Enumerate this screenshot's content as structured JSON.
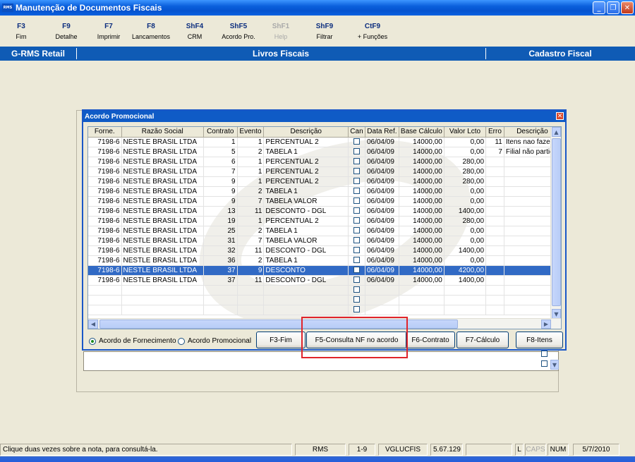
{
  "window": {
    "title": "Manutenção de Documentos Fiscais",
    "icon_text": "RMS",
    "controls": [
      "minimize-icon",
      "restore-icon",
      "close-icon"
    ]
  },
  "fkeys": [
    {
      "key": "F3",
      "label": "Fim"
    },
    {
      "key": "F9",
      "label": "Detalhe"
    },
    {
      "key": "F7",
      "label": "Imprimir"
    },
    {
      "key": "F8",
      "label": "Lancamentos"
    },
    {
      "key": "ShF4",
      "label": "CRM"
    },
    {
      "key": "ShF5",
      "label": "Acordo Pro."
    },
    {
      "key": "ShF1",
      "label": "Help",
      "disabled": true
    },
    {
      "key": "ShF9",
      "label": "Filtrar"
    },
    {
      "key": "CtF9",
      "label": "+ Funções"
    }
  ],
  "header": {
    "left": "G-RMS Retail",
    "center": "Livros Fiscais",
    "right": "Cadastro Fiscal"
  },
  "dialog": {
    "title": "Acordo Promocional",
    "columns": [
      "Forne.",
      "Razão Social",
      "Contrato",
      "Evento",
      "Descrição",
      "Can",
      "Data Ref.",
      "Base Cálculo",
      "Valor Lcto",
      "Erro",
      "Descrição"
    ],
    "rows": [
      [
        "7198-6",
        "NESTLE BRASIL LTDA",
        "1",
        "1",
        "PERCENTUAL 2",
        "",
        "06/04/09",
        "14000,00",
        "0,00",
        "11",
        "Itens nao fazem"
      ],
      [
        "7198-6",
        "NESTLE BRASIL LTDA",
        "5",
        "2",
        "TABELA 1",
        "",
        "06/04/09",
        "14000,00",
        "0,00",
        "7",
        "Filial não particip"
      ],
      [
        "7198-6",
        "NESTLE BRASIL LTDA",
        "6",
        "1",
        "PERCENTUAL 2",
        "",
        "06/04/09",
        "14000,00",
        "280,00",
        "",
        ""
      ],
      [
        "7198-6",
        "NESTLE BRASIL LTDA",
        "7",
        "1",
        "PERCENTUAL 2",
        "",
        "06/04/09",
        "14000,00",
        "280,00",
        "",
        ""
      ],
      [
        "7198-6",
        "NESTLE BRASIL LTDA",
        "9",
        "1",
        "PERCENTUAL 2",
        "",
        "06/04/09",
        "14000,00",
        "280,00",
        "",
        ""
      ],
      [
        "7198-6",
        "NESTLE BRASIL LTDA",
        "9",
        "2",
        "TABELA 1",
        "",
        "06/04/09",
        "14000,00",
        "0,00",
        "",
        ""
      ],
      [
        "7198-6",
        "NESTLE BRASIL LTDA",
        "9",
        "7",
        "TABELA VALOR",
        "",
        "06/04/09",
        "14000,00",
        "0,00",
        "",
        ""
      ],
      [
        "7198-6",
        "NESTLE BRASIL LTDA",
        "13",
        "11",
        "DESCONTO - DGL",
        "",
        "06/04/09",
        "14000,00",
        "1400,00",
        "",
        ""
      ],
      [
        "7198-6",
        "NESTLE BRASIL LTDA",
        "19",
        "1",
        "PERCENTUAL 2",
        "",
        "06/04/09",
        "14000,00",
        "280,00",
        "",
        ""
      ],
      [
        "7198-6",
        "NESTLE BRASIL LTDA",
        "25",
        "2",
        "TABELA 1",
        "",
        "06/04/09",
        "14000,00",
        "0,00",
        "",
        ""
      ],
      [
        "7198-6",
        "NESTLE BRASIL LTDA",
        "31",
        "7",
        "TABELA VALOR",
        "",
        "06/04/09",
        "14000,00",
        "0,00",
        "",
        ""
      ],
      [
        "7198-6",
        "NESTLE BRASIL LTDA",
        "32",
        "11",
        "DESCONTO - DGL",
        "",
        "06/04/09",
        "14000,00",
        "1400,00",
        "",
        ""
      ],
      [
        "7198-6",
        "NESTLE BRASIL LTDA",
        "36",
        "2",
        "TABELA 1",
        "",
        "06/04/09",
        "14000,00",
        "0,00",
        "",
        ""
      ],
      [
        "7198-6",
        "NESTLE BRASIL LTDA",
        "37",
        "9",
        "DESCONTO",
        "",
        "06/04/09",
        "14000,00",
        "4200,00",
        "",
        ""
      ],
      [
        "7198-6",
        "NESTLE BRASIL LTDA",
        "37",
        "11",
        "DESCONTO - DGL",
        "",
        "06/04/09",
        "14000,00",
        "1400,00",
        "",
        ""
      ]
    ],
    "selected_row": 13,
    "radio": [
      {
        "label": "Acordo de Fornecimento",
        "checked": true
      },
      {
        "label": "Acordo Promocional",
        "checked": false
      }
    ],
    "buttons": [
      "F3-Fim",
      "F5-Consulta NF no acordo",
      "F6-Contrato",
      "F7-Cálculo",
      "F8-Itens"
    ]
  },
  "statusbar": {
    "message": "Clique duas vezes sobre a nota, para consultá-la.",
    "system": "RMS",
    "record": "1-9",
    "user": "VGLUCFIS",
    "version": "5.67.129",
    "caps_l": "L",
    "caps": "CAPS",
    "num": "NUM",
    "date": "5/7/2010"
  },
  "colors": {
    "header_blue": "#0f5bb5",
    "selection": "#316ac5",
    "highlight_box": "#e0242b"
  }
}
